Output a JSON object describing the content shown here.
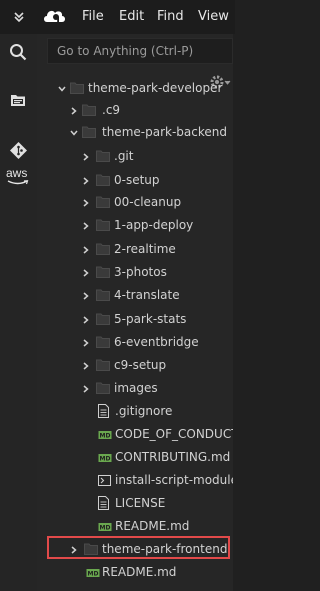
{
  "menubar": {
    "items": [
      {
        "label": "File"
      },
      {
        "label": "Edit"
      },
      {
        "label": "Find"
      },
      {
        "label": "View"
      }
    ]
  },
  "sidebar": {
    "icons": [
      {
        "icon": "search-icon"
      },
      {
        "icon": "folder-icon"
      },
      {
        "icon": "git-icon"
      },
      {
        "icon": "aws-icon",
        "label": "aws"
      }
    ]
  },
  "search": {
    "placeholder": "Go to Anything (Ctrl-P)"
  },
  "tree": {
    "items": [
      {
        "label": "theme-park-developer",
        "type": "folder",
        "expanded": true
      },
      {
        "label": ".c9",
        "type": "folder",
        "expanded": false
      },
      {
        "label": "theme-park-backend",
        "type": "folder",
        "expanded": true
      },
      {
        "label": ".git",
        "type": "folder",
        "expanded": false
      },
      {
        "label": "0-setup",
        "type": "folder",
        "expanded": false
      },
      {
        "label": "00-cleanup",
        "type": "folder",
        "expanded": false
      },
      {
        "label": "1-app-deploy",
        "type": "folder",
        "expanded": false
      },
      {
        "label": "2-realtime",
        "type": "folder",
        "expanded": false
      },
      {
        "label": "3-photos",
        "type": "folder",
        "expanded": false
      },
      {
        "label": "4-translate",
        "type": "folder",
        "expanded": false
      },
      {
        "label": "5-park-stats",
        "type": "folder",
        "expanded": false
      },
      {
        "label": "6-eventbridge",
        "type": "folder",
        "expanded": false
      },
      {
        "label": "c9-setup",
        "type": "folder",
        "expanded": false
      },
      {
        "label": "images",
        "type": "folder",
        "expanded": false
      },
      {
        "label": ".gitignore",
        "type": "file"
      },
      {
        "label": "CODE_OF_CONDUCT.md",
        "type": "md"
      },
      {
        "label": "CONTRIBUTING.md",
        "type": "md"
      },
      {
        "label": "install-script-modules.sh",
        "type": "sh"
      },
      {
        "label": "LICENSE",
        "type": "file"
      },
      {
        "label": "README.md",
        "type": "md"
      },
      {
        "label": "theme-park-frontend",
        "type": "folder",
        "expanded": false
      },
      {
        "label": "README.md",
        "type": "md"
      }
    ]
  },
  "colors": {
    "background": "#202020",
    "text": "#d2d2d2",
    "highlight_border": "#e24a4a",
    "md_icon": "#6aa84f"
  }
}
